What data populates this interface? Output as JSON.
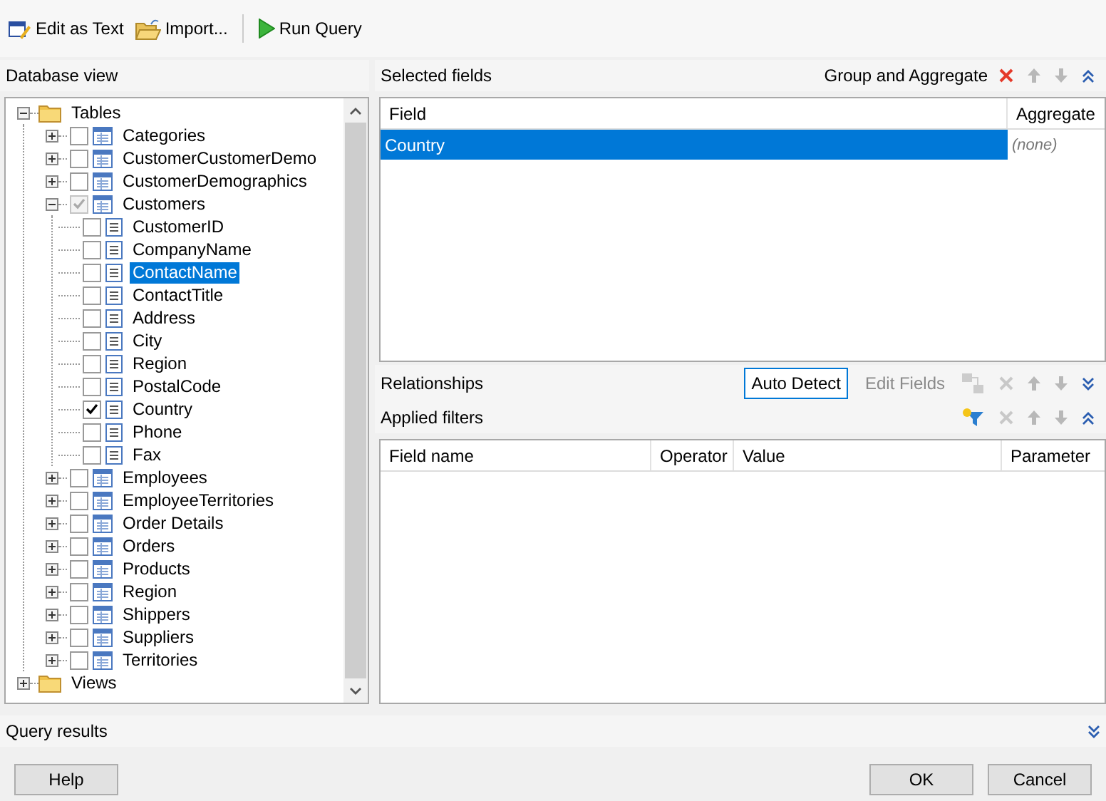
{
  "toolbar": [
    {
      "kind": "edit",
      "label": "Edit as Text"
    },
    {
      "kind": "import",
      "label": "Import..."
    },
    {
      "kind": "run",
      "label": "Run Query"
    }
  ],
  "database_view": {
    "title": "Database view",
    "tree": [
      {
        "kind": "folder",
        "label": "Tables",
        "expanded": true,
        "children": [
          {
            "kind": "table",
            "label": "Categories",
            "expanded": false,
            "checked": false,
            "indeterminate": false
          },
          {
            "kind": "table",
            "label": "CustomerCustomerDemo",
            "expanded": false,
            "checked": false,
            "indeterminate": false
          },
          {
            "kind": "table",
            "label": "CustomerDemographics",
            "expanded": false,
            "checked": false,
            "indeterminate": false
          },
          {
            "kind": "table",
            "label": "Customers",
            "expanded": true,
            "checked": true,
            "indeterminate": true,
            "children": [
              {
                "kind": "field",
                "label": "CustomerID",
                "checked": false,
                "selected": false
              },
              {
                "kind": "field",
                "label": "CompanyName",
                "checked": false,
                "selected": false
              },
              {
                "kind": "field",
                "label": "ContactName",
                "checked": false,
                "selected": true
              },
              {
                "kind": "field",
                "label": "ContactTitle",
                "checked": false,
                "selected": false
              },
              {
                "kind": "field",
                "label": "Address",
                "checked": false,
                "selected": false
              },
              {
                "kind": "field",
                "label": "City",
                "checked": false,
                "selected": false
              },
              {
                "kind": "field",
                "label": "Region",
                "checked": false,
                "selected": false
              },
              {
                "kind": "field",
                "label": "PostalCode",
                "checked": false,
                "selected": false
              },
              {
                "kind": "field",
                "label": "Country",
                "checked": true,
                "selected": false
              },
              {
                "kind": "field",
                "label": "Phone",
                "checked": false,
                "selected": false
              },
              {
                "kind": "field",
                "label": "Fax",
                "checked": false,
                "selected": false
              }
            ]
          },
          {
            "kind": "table",
            "label": "Employees",
            "expanded": false,
            "checked": false,
            "indeterminate": false
          },
          {
            "kind": "table",
            "label": "EmployeeTerritories",
            "expanded": false,
            "checked": false,
            "indeterminate": false
          },
          {
            "kind": "table",
            "label": "Order Details",
            "expanded": false,
            "checked": false,
            "indeterminate": false
          },
          {
            "kind": "table",
            "label": "Orders",
            "expanded": false,
            "checked": false,
            "indeterminate": false
          },
          {
            "kind": "table",
            "label": "Products",
            "expanded": false,
            "checked": false,
            "indeterminate": false
          },
          {
            "kind": "table",
            "label": "Region",
            "expanded": false,
            "checked": false,
            "indeterminate": false
          },
          {
            "kind": "table",
            "label": "Shippers",
            "expanded": false,
            "checked": false,
            "indeterminate": false
          },
          {
            "kind": "table",
            "label": "Suppliers",
            "expanded": false,
            "checked": false,
            "indeterminate": false
          },
          {
            "kind": "table",
            "label": "Territories",
            "expanded": false,
            "checked": false,
            "indeterminate": false
          }
        ]
      },
      {
        "kind": "folder",
        "label": "Views",
        "expanded": false
      }
    ]
  },
  "selected_fields": {
    "title": "Selected fields",
    "action": "Group and Aggregate",
    "tools": [
      {
        "kind": "delete",
        "disabled": false
      },
      {
        "kind": "up",
        "disabled": true
      },
      {
        "kind": "down",
        "disabled": true
      },
      {
        "kind": "collapse",
        "disabled": false
      }
    ],
    "columns": [
      "Field",
      "Aggregate"
    ],
    "rows": [
      {
        "field": "Country",
        "aggregate": "(none)",
        "selected": true
      }
    ]
  },
  "relationships": {
    "title": "Relationships",
    "buttons": [
      {
        "label": "Auto Detect",
        "disabled": false
      },
      {
        "label": "Edit Fields",
        "disabled": true
      }
    ],
    "tools": [
      {
        "kind": "link",
        "disabled": true
      },
      {
        "kind": "delete",
        "disabled": true
      },
      {
        "kind": "up",
        "disabled": true
      },
      {
        "kind": "down",
        "disabled": true
      },
      {
        "kind": "expand",
        "disabled": false
      }
    ]
  },
  "applied_filters": {
    "title": "Applied filters",
    "tools": [
      {
        "kind": "add-filter",
        "disabled": false
      },
      {
        "kind": "delete",
        "disabled": true
      },
      {
        "kind": "up",
        "disabled": true
      },
      {
        "kind": "down",
        "disabled": true
      },
      {
        "kind": "collapse",
        "disabled": false
      }
    ],
    "columns": [
      "Field name",
      "Operator",
      "Value",
      "Parameter"
    ]
  },
  "query_results": {
    "title": "Query results"
  },
  "buttons": {
    "help": "Help",
    "ok": "OK",
    "cancel": "Cancel"
  }
}
